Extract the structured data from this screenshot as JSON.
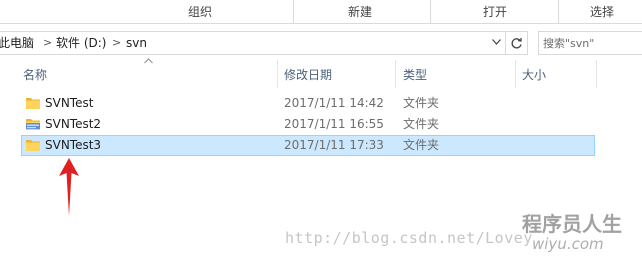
{
  "ribbon": {
    "groups": [
      "组织",
      "新建",
      "打开",
      "选择"
    ]
  },
  "address": {
    "breadcrumbs": [
      "此电脑",
      "软件 (D:)",
      "svn"
    ],
    "separator": ">",
    "dropdown_icon": "chevron-down-icon",
    "refresh_icon": "refresh-icon"
  },
  "search": {
    "placeholder": "搜索\"svn\""
  },
  "columns": {
    "name": "名称",
    "date": "修改日期",
    "type": "类型",
    "size": "大小"
  },
  "files": [
    {
      "name": "SVNTest",
      "date": "2017/1/11 14:42",
      "type": "文件夹",
      "icon": "folder-icon",
      "selected": false
    },
    {
      "name": "SVNTest2",
      "date": "2017/1/11 16:55",
      "type": "文件夹",
      "icon": "svn-folder-icon",
      "selected": false
    },
    {
      "name": "SVNTest3",
      "date": "2017/1/11 17:33",
      "type": "文件夹",
      "icon": "folder-icon",
      "selected": true
    }
  ],
  "annotation": {
    "color": "#e02020"
  },
  "watermark": {
    "url": "http://blog.csdn.net/Lovey",
    "logo": "程序员人生",
    "site": "wiyu.com"
  },
  "colors": {
    "selection_bg": "#cce8ff",
    "selection_border": "#99d1ff",
    "folder": "#ffd45c"
  }
}
